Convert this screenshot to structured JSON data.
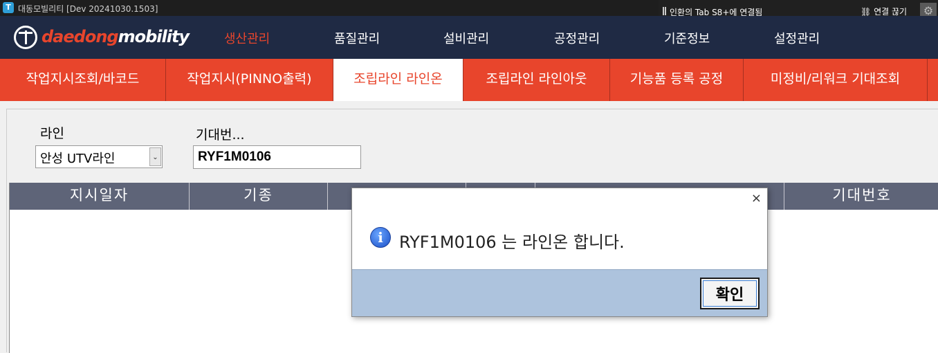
{
  "window": {
    "title": "대동모빌리티 [Dev 20241030.1503]"
  },
  "remote_session": {
    "status": "인환의 Tab S8+에 연결됨",
    "disconnect_label": "연결 끊기"
  },
  "brand": {
    "logo_part1": "daedong",
    "logo_part2": "mobility"
  },
  "nav": {
    "items": [
      "생산관리",
      "품질관리",
      "설비관리",
      "공정관리",
      "기준정보",
      "설정관리"
    ],
    "active": "생산관리"
  },
  "tabs": {
    "items": [
      "작업지시조회/바코드",
      "작업지시(PINNO출력)",
      "조립라인 라인온",
      "조립라인 라인아웃",
      "기능품 등록 공정",
      "미정비/리워크 기대조회"
    ],
    "active": "조립라인 라인온"
  },
  "form": {
    "line_label": "라인",
    "line_value": "안성 UTV라인",
    "jig_label": "기대번...",
    "jig_value": "RYF1M0106"
  },
  "grid": {
    "columns": [
      "지시일자",
      "기종",
      "",
      "",
      "",
      "기대번호"
    ],
    "rows": []
  },
  "dialog": {
    "message": "RYF1M0106 는 라인온 합니다.",
    "ok_label": "확인",
    "close_label": "×"
  },
  "colors": {
    "accent": "#e8452c",
    "nav_bg": "#1f2a44",
    "grid_header_bg": "#5e6478",
    "dialog_footer_bg": "#adc3dd"
  }
}
